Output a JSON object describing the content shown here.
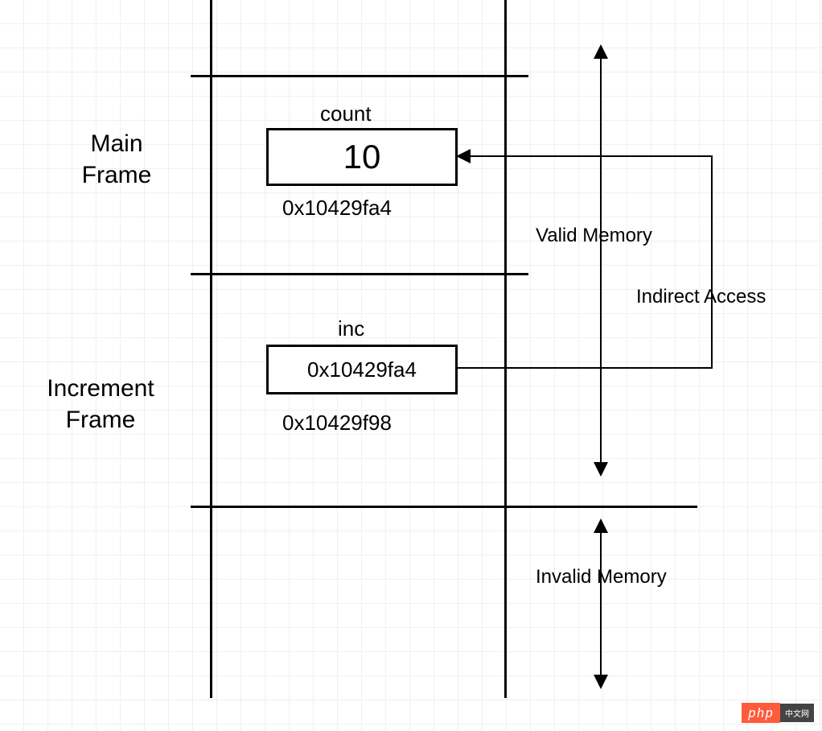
{
  "frames": {
    "main": {
      "title": "Main\nFrame"
    },
    "increment": {
      "title": "Increment\nFrame"
    }
  },
  "count": {
    "label": "count",
    "value": "10",
    "address": "0x10429fa4"
  },
  "inc": {
    "label": "inc",
    "value": "0x10429fa4",
    "address": "0x10429f98"
  },
  "annotations": {
    "valid_memory": "Valid Memory",
    "indirect_access": "Indirect Access",
    "invalid_memory": "Invalid Memory"
  },
  "watermark": {
    "badge": "php",
    "text": "中文网"
  }
}
